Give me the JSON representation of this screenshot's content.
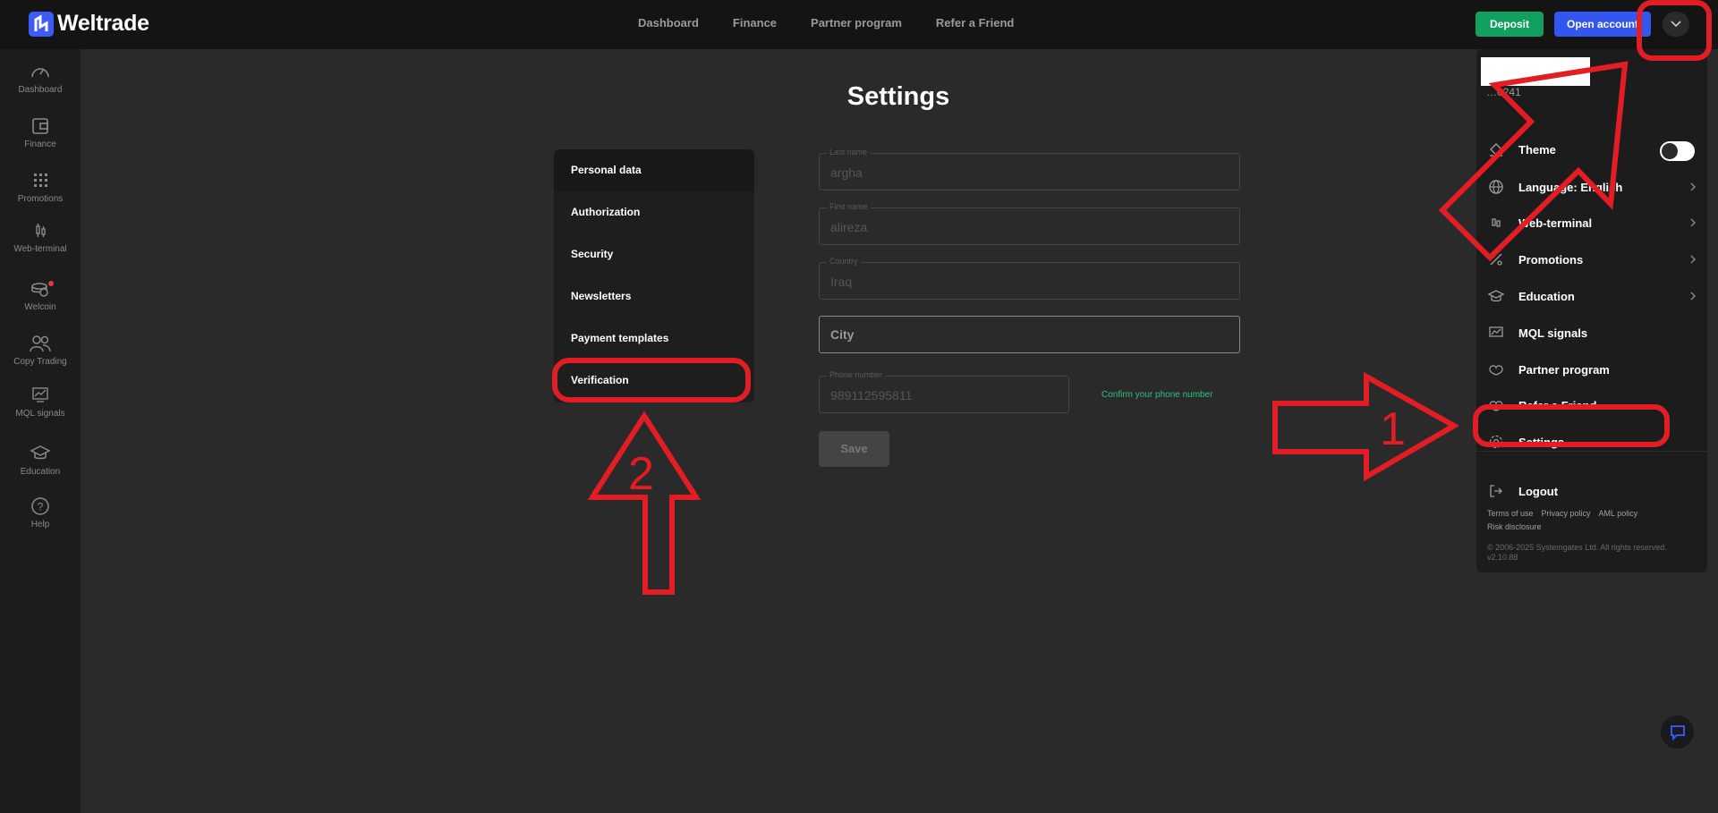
{
  "brand": {
    "name": "Weltrade"
  },
  "topnav": [
    "Dashboard",
    "Finance",
    "Partner program",
    "Refer a Friend"
  ],
  "header_buttons": {
    "deposit": "Deposit",
    "open_account": "Open account"
  },
  "sidebar": [
    {
      "label": "Dashboard",
      "icon": "speedometer-icon"
    },
    {
      "label": "Finance",
      "icon": "wallet-icon"
    },
    {
      "label": "Promotions",
      "icon": "grid-icon"
    },
    {
      "label": "Web-terminal",
      "icon": "candles-icon"
    },
    {
      "label": "Welcoin",
      "icon": "coins-icon"
    },
    {
      "label": "Copy Trading",
      "icon": "people-icon"
    },
    {
      "label": "MQL signals",
      "icon": "chart-icon"
    },
    {
      "label": "Education",
      "icon": "graduation-cap-icon"
    },
    {
      "label": "Help",
      "icon": "help-icon"
    }
  ],
  "page_title": "Settings",
  "settings_menu": [
    "Personal data",
    "Authorization",
    "Security",
    "Newsletters",
    "Payment templates",
    "Verification"
  ],
  "form": {
    "last_name": {
      "label": "Last name",
      "value": "argha"
    },
    "first_name": {
      "label": "First name",
      "value": "alireza"
    },
    "country": {
      "label": "Country",
      "value": "Iraq"
    },
    "city": {
      "placeholder": "City"
    },
    "phone": {
      "label": "Phone number",
      "value": "989112595811"
    },
    "confirm_link": "Confirm your phone number",
    "save": "Save"
  },
  "dropdown": {
    "account_partial": "…0241",
    "items": [
      {
        "label": "Theme",
        "icon": "paint-bucket-icon"
      },
      {
        "label": "Language: English",
        "icon": "globe-icon"
      },
      {
        "label": "Web-terminal",
        "icon": "candles-icon"
      },
      {
        "label": "Promotions",
        "icon": "percent-icon"
      },
      {
        "label": "Education",
        "icon": "graduation-cap-icon"
      },
      {
        "label": "MQL signals",
        "icon": "chart-icon"
      },
      {
        "label": "Partner program",
        "icon": "handshake-icon"
      },
      {
        "label": "Refer a Friend",
        "icon": "handshake-icon"
      },
      {
        "label": "Settings",
        "icon": "gear-icon"
      },
      {
        "label": "Logout",
        "icon": "logout-icon"
      }
    ],
    "footer_links": [
      "Terms of use",
      "Privacy policy",
      "AML policy",
      "Risk disclosure"
    ],
    "copyright": "© 2006-2025 Systemgates Ltd. All rights reserved.",
    "version": "v2.10.88"
  },
  "annotations": {
    "step1": "1",
    "step2": "2"
  },
  "colors": {
    "accent_blue": "#3456f0",
    "deposit_green": "#12a060",
    "annotation_red": "#e21d24",
    "confirm_green": "#2ec27e"
  }
}
